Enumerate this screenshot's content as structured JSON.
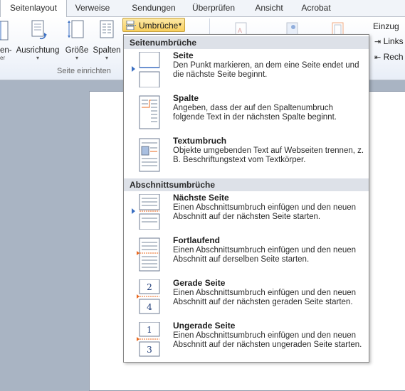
{
  "tabs": [
    {
      "label": "Seitenlayout",
      "active": true
    },
    {
      "label": "Verweise",
      "active": false
    },
    {
      "label": "Sendungen",
      "active": false
    },
    {
      "label": "Überprüfen",
      "active": false
    },
    {
      "label": "Ansicht",
      "active": false
    },
    {
      "label": "Acrobat",
      "active": false
    }
  ],
  "ribbon": {
    "partial_label_1": "en-",
    "partial_label_2": "er",
    "ausrichtung": "Ausrichtung",
    "groesse": "Größe",
    "spalten": "Spalten",
    "group_label": "Seite einrichten",
    "umbrueche": "Umbrüche",
    "einzug": "Einzug",
    "links": "Links",
    "rechts": "Rech"
  },
  "menu": {
    "section1": "Seitenumbrüche",
    "section2": "Abschnittsumbrüche",
    "items": [
      {
        "title": "Seite",
        "desc": "Den Punkt markieren, an dem eine Seite endet und die nächste Seite beginnt."
      },
      {
        "title": "Spalte",
        "desc": "Angeben, dass der auf den Spaltenumbruch folgende Text in der nächsten Spalte beginnt."
      },
      {
        "title": "Textumbruch",
        "desc": "Objekte umgebenden Text auf Webseiten trennen, z. B. Beschriftungstext vom Textkörper."
      },
      {
        "title": "Nächste Seite",
        "desc": "Einen Abschnittsumbruch einfügen und den neuen Abschnitt auf der nächsten Seite starten."
      },
      {
        "title": "Fortlaufend",
        "desc": "Einen Abschnittsumbruch einfügen und den neuen Abschnitt auf derselben Seite starten."
      },
      {
        "title": "Gerade Seite",
        "desc": "Einen Abschnittsumbruch einfügen und den neuen Abschnitt auf der nächsten geraden Seite starten."
      },
      {
        "title": "Ungerade Seite",
        "desc": "Einen Abschnittsumbruch einfügen und den neuen Abschnitt auf der nächsten ungeraden Seite starten."
      }
    ],
    "thumb_numbers": {
      "even": "2",
      "even_next": "4",
      "odd": "1",
      "odd_next": "3"
    }
  },
  "icons": {
    "orientation": "orientation-icon",
    "size": "size-icon",
    "columns": "columns-icon",
    "breaks": "breaks-icon",
    "indent_left": "indent-left-icon",
    "indent_right": "indent-right-icon"
  },
  "colors": {
    "accent_orange": "#e8671e",
    "selection_blue": "#3b6fc2",
    "button_highlight": "#f8cf5e"
  }
}
